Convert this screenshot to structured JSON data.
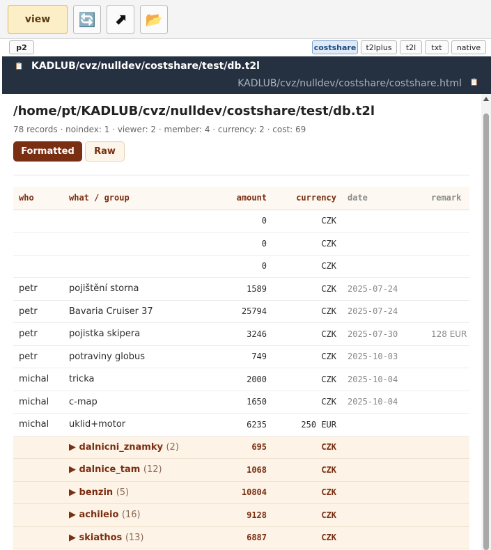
{
  "toolbar": {
    "view_label": "view",
    "refresh_icon": "🔄",
    "open_icon": "⬈",
    "folder_icon": "📂"
  },
  "formats": {
    "profile": "p2",
    "items": [
      "costshare",
      "t2lplus",
      "t2l",
      "txt",
      "native"
    ],
    "active": "costshare"
  },
  "pathbar": {
    "title": "KADLUB/cvz/nulldev/costshare/test/db.t2l",
    "subtitle": "KADLUB/cvz/nulldev/costshare/costshare.html",
    "clipboard_icon": "📋"
  },
  "document": {
    "path": "/home/pt/KADLUB/cvz/nulldev/costshare/test/db.t2l",
    "stats": "78 records · noindex: 1 · viewer: 2 · member: 4 · currency: 2 · cost: 69",
    "btn_formatted": "Formatted",
    "btn_raw": "Raw"
  },
  "table": {
    "headers": [
      "who",
      "what / group",
      "amount",
      "currency",
      "date",
      "remark"
    ],
    "rows": [
      {
        "who": "",
        "what": "",
        "amount": "0",
        "currency": "CZK",
        "date": "",
        "remark": ""
      },
      {
        "who": "",
        "what": "",
        "amount": "0",
        "currency": "CZK",
        "date": "",
        "remark": ""
      },
      {
        "who": "",
        "what": "",
        "amount": "0",
        "currency": "CZK",
        "date": "",
        "remark": ""
      },
      {
        "who": "petr",
        "what": "pojištění storna",
        "amount": "1589",
        "currency": "CZK",
        "date": "2025-07-24",
        "remark": ""
      },
      {
        "who": "petr",
        "what": "Bavaria Cruiser 37",
        "amount": "25794",
        "currency": "CZK",
        "date": "2025-07-24",
        "remark": ""
      },
      {
        "who": "petr",
        "what": "pojistka skipera",
        "amount": "3246",
        "currency": "CZK",
        "date": "2025-07-30",
        "remark": "128 EUR"
      },
      {
        "who": "petr",
        "what": "potraviny globus",
        "amount": "749",
        "currency": "CZK",
        "date": "2025-10-03",
        "remark": ""
      },
      {
        "who": "michal",
        "what": "tricka",
        "amount": "2000",
        "currency": "CZK",
        "date": "2025-10-04",
        "remark": ""
      },
      {
        "who": "michal",
        "what": "c-map",
        "amount": "1650",
        "currency": "CZK",
        "date": "2025-10-04",
        "remark": ""
      },
      {
        "who": "michal",
        "what": "uklid+motor",
        "amount": "6235",
        "currency": "250 EUR",
        "date": "",
        "remark": ""
      }
    ],
    "groups": [
      {
        "name": "dalnicni_znamky",
        "count": "(2)",
        "amount": "695",
        "currency": "CZK"
      },
      {
        "name": "dalnice_tam",
        "count": "(12)",
        "amount": "1068",
        "currency": "CZK"
      },
      {
        "name": "benzin",
        "count": "(5)",
        "amount": "10804",
        "currency": "CZK"
      },
      {
        "name": "achileio",
        "count": "(16)",
        "amount": "9128",
        "currency": "CZK"
      },
      {
        "name": "skiathos",
        "count": "(13)",
        "amount": "6887",
        "currency": "CZK"
      }
    ]
  },
  "colors": {
    "accent": "#7a2e12",
    "header_bg": "#253140",
    "group_bg": "#fdf3e6",
    "active_format": "#dfeaf8"
  }
}
